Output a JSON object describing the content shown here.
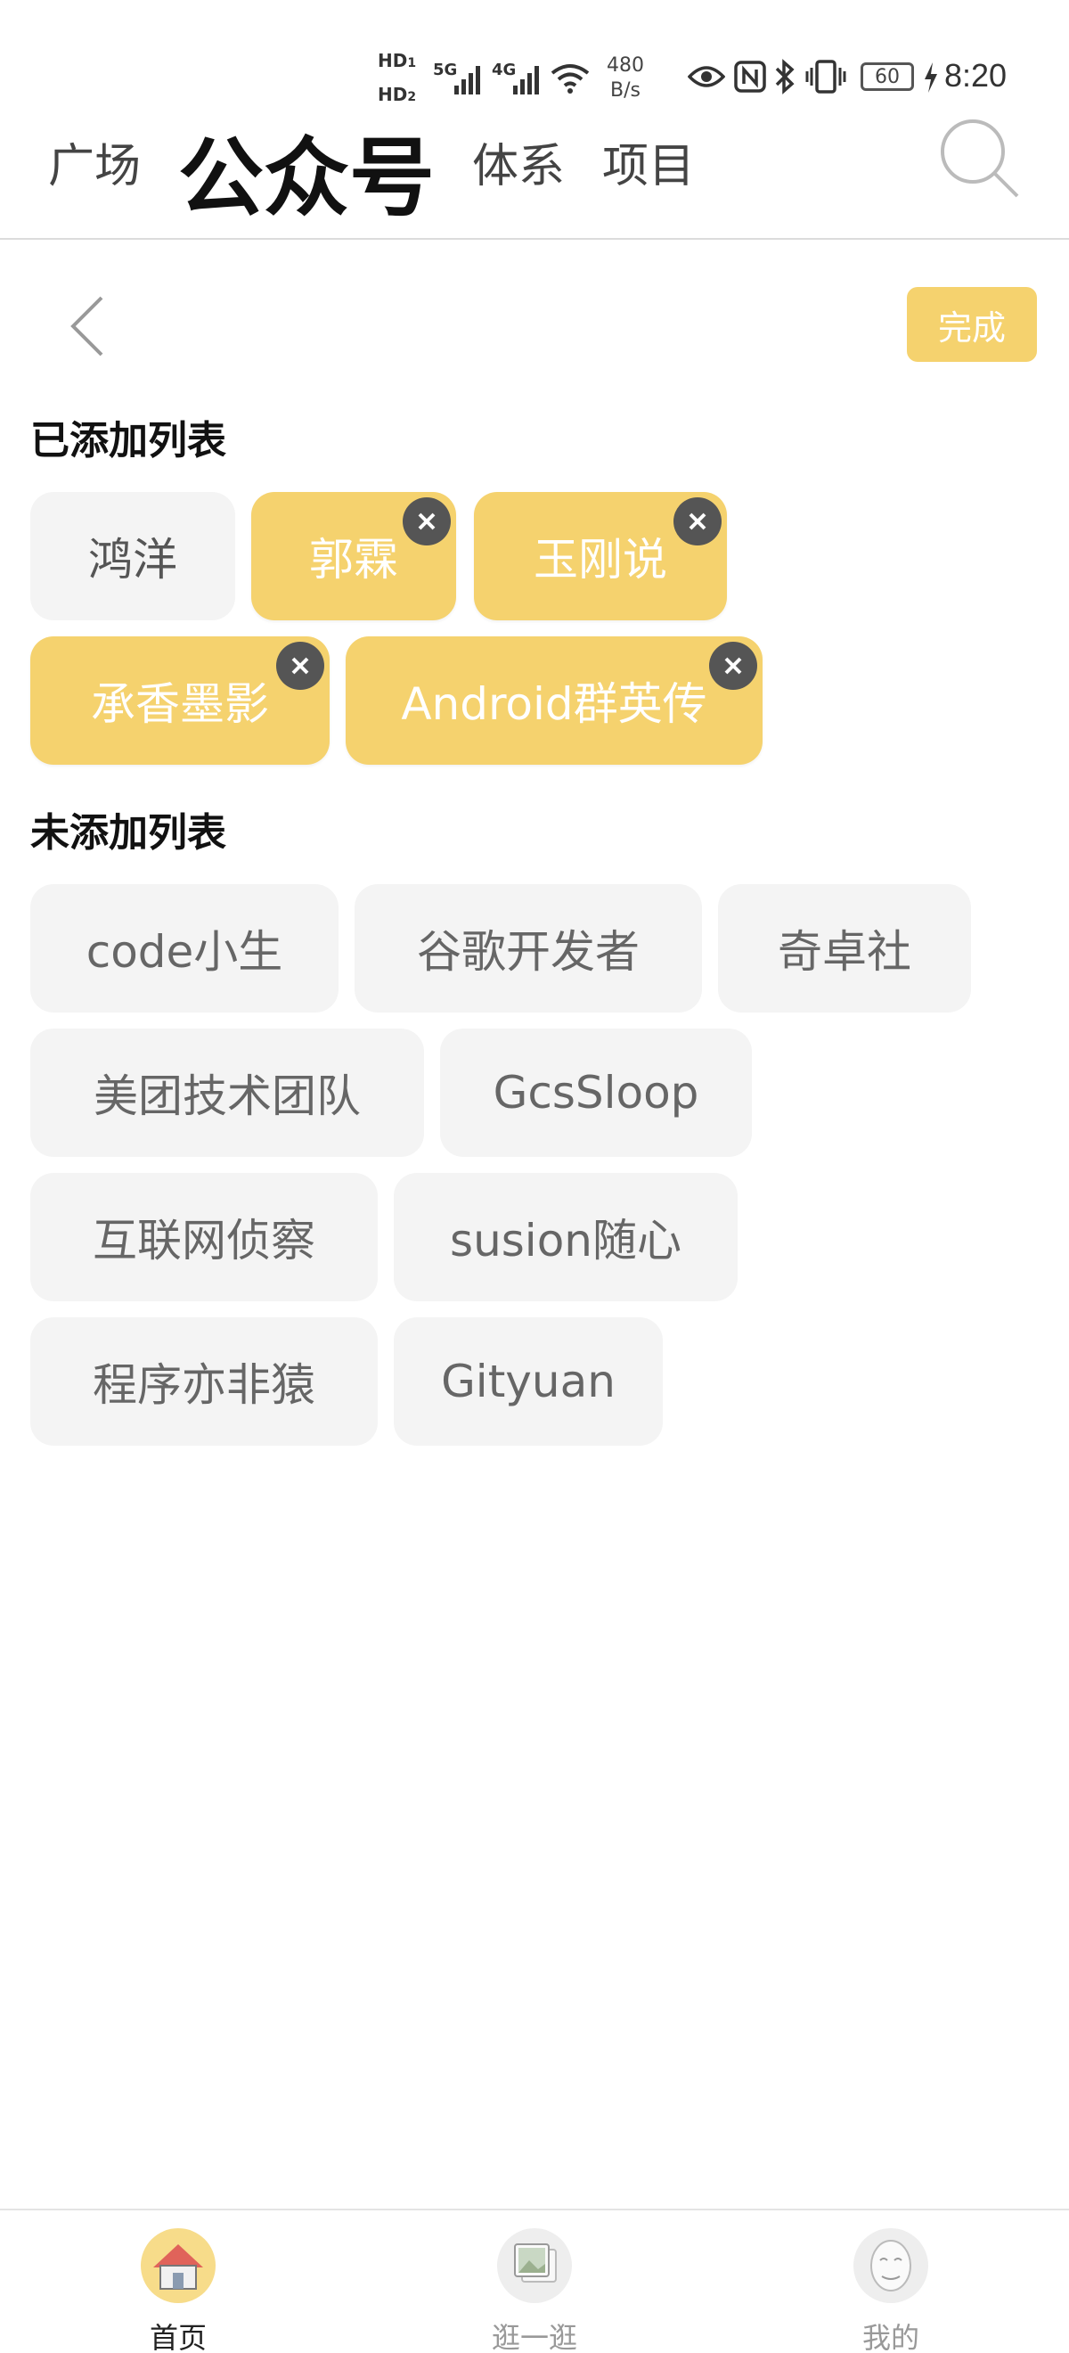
{
  "status_bar": {
    "hd1": "HD",
    "hd1_sub": "1",
    "hd2": "HD",
    "hd2_sub": "2",
    "net1": "5G",
    "net2": "4G",
    "speed_value": "480",
    "speed_unit": "B/s",
    "battery": "60",
    "time": "8:20",
    "icons": [
      "eye-icon",
      "nfc-icon",
      "bluetooth-icon",
      "vibrate-icon",
      "battery-icon",
      "charging-icon",
      "wifi-icon",
      "signal-icon"
    ]
  },
  "top_tabs": {
    "tab1": "广场",
    "tab2": "公众号",
    "tab3": "体系",
    "tab4": "项目"
  },
  "toolbar": {
    "done_label": "完成"
  },
  "added_section": {
    "title": "已添加列表",
    "items": [
      "鸿洋",
      "郭霖",
      "玉刚说",
      "承香墨影",
      "Android群英传"
    ]
  },
  "unadded_section": {
    "title": "未添加列表",
    "items": [
      "code小生",
      "谷歌开发者",
      "奇卓社",
      "美团技术团队",
      "GcsSloop",
      "互联网侦察",
      "susion随心",
      "程序亦非猿",
      "Gityuan"
    ]
  },
  "bottom_nav": {
    "home": "首页",
    "explore": "逛一逛",
    "mine": "我的"
  },
  "colors": {
    "accent": "#f5d26e",
    "chip_bg": "#f4f4f4",
    "remove_badge": "#555555"
  }
}
